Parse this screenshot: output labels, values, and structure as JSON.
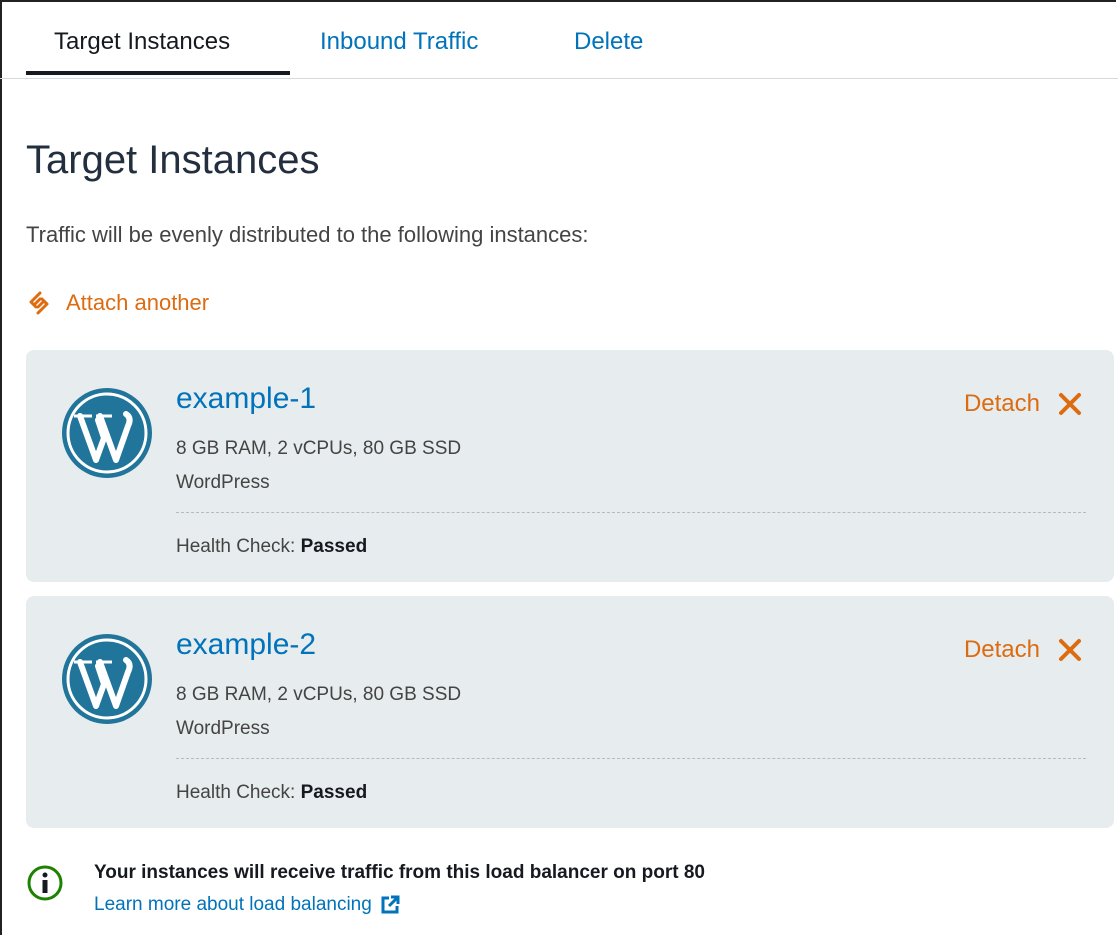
{
  "tabs": [
    {
      "label": "Target Instances",
      "active": true
    },
    {
      "label": "Inbound Traffic",
      "active": false
    },
    {
      "label": "Delete",
      "active": false
    }
  ],
  "page": {
    "title": "Target Instances",
    "description": "Traffic will be evenly distributed to the following instances:",
    "attach_label": "Attach another"
  },
  "instances": [
    {
      "name": "example-1",
      "specs": "8 GB RAM, 2 vCPUs, 80 GB SSD",
      "blueprint": "WordPress",
      "health_label": "Health Check:",
      "health_status": "Passed",
      "detach_label": "Detach",
      "icon": "wordpress-icon"
    },
    {
      "name": "example-2",
      "specs": "8 GB RAM, 2 vCPUs, 80 GB SSD",
      "blueprint": "WordPress",
      "health_label": "Health Check:",
      "health_status": "Passed",
      "detach_label": "Detach",
      "icon": "wordpress-icon"
    }
  ],
  "info": {
    "message": "Your instances will receive traffic from this load balancer on port 80",
    "link_label": "Learn more about load balancing",
    "icon": "info-icon"
  },
  "colors": {
    "link_blue": "#0073bb",
    "action_orange": "#dd6b10",
    "card_bg": "#e7ecee",
    "info_green": "#1d8102"
  }
}
